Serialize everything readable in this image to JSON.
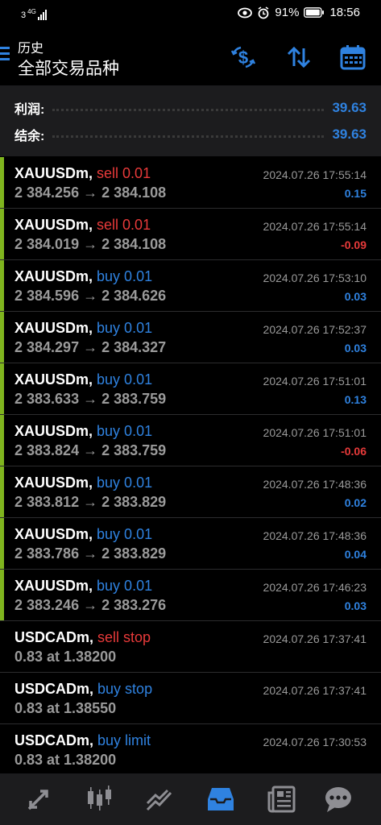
{
  "status_bar": {
    "network": "4G",
    "sim": "3",
    "battery": "91%",
    "time": "18:56"
  },
  "header": {
    "section": "历史",
    "title": "全部交易品种"
  },
  "summary": {
    "profit_label": "利润:",
    "profit_value": "39.63",
    "balance_label": "结余:",
    "balance_value": "39.63"
  },
  "rows": [
    {
      "symbol": "XAUUSDm,",
      "type": "sell 0.01",
      "side": "sell",
      "prices": "2 384.256 → 2 384.108",
      "time": "2024.07.26 17:55:14",
      "pl": "0.15",
      "pl_sign": "pos",
      "closed": true
    },
    {
      "symbol": "XAUUSDm,",
      "type": "sell 0.01",
      "side": "sell",
      "prices": "2 384.019 → 2 384.108",
      "time": "2024.07.26 17:55:14",
      "pl": "-0.09",
      "pl_sign": "neg",
      "closed": true
    },
    {
      "symbol": "XAUUSDm,",
      "type": "buy 0.01",
      "side": "buy",
      "prices": "2 384.596 → 2 384.626",
      "time": "2024.07.26 17:53:10",
      "pl": "0.03",
      "pl_sign": "pos",
      "closed": true
    },
    {
      "symbol": "XAUUSDm,",
      "type": "buy 0.01",
      "side": "buy",
      "prices": "2 384.297 → 2 384.327",
      "time": "2024.07.26 17:52:37",
      "pl": "0.03",
      "pl_sign": "pos",
      "closed": true
    },
    {
      "symbol": "XAUUSDm,",
      "type": "buy 0.01",
      "side": "buy",
      "prices": "2 383.633 → 2 383.759",
      "time": "2024.07.26 17:51:01",
      "pl": "0.13",
      "pl_sign": "pos",
      "closed": true
    },
    {
      "symbol": "XAUUSDm,",
      "type": "buy 0.01",
      "side": "buy",
      "prices": "2 383.824 → 2 383.759",
      "time": "2024.07.26 17:51:01",
      "pl": "-0.06",
      "pl_sign": "neg",
      "closed": true
    },
    {
      "symbol": "XAUUSDm,",
      "type": "buy 0.01",
      "side": "buy",
      "prices": "2 383.812 → 2 383.829",
      "time": "2024.07.26 17:48:36",
      "pl": "0.02",
      "pl_sign": "pos",
      "closed": true
    },
    {
      "symbol": "XAUUSDm,",
      "type": "buy 0.01",
      "side": "buy",
      "prices": "2 383.786 → 2 383.829",
      "time": "2024.07.26 17:48:36",
      "pl": "0.04",
      "pl_sign": "pos",
      "closed": true
    },
    {
      "symbol": "XAUUSDm,",
      "type": "buy 0.01",
      "side": "buy",
      "prices": "2 383.246 → 2 383.276",
      "time": "2024.07.26 17:46:23",
      "pl": "0.03",
      "pl_sign": "pos",
      "closed": true
    },
    {
      "symbol": "USDCADm,",
      "type": "sell stop",
      "side": "sell",
      "prices": "0.83 at 1.38200",
      "time": "2024.07.26 17:37:41",
      "pl": "",
      "pl_sign": "pos",
      "closed": false
    },
    {
      "symbol": "USDCADm,",
      "type": "buy stop",
      "side": "buy",
      "prices": "0.83 at 1.38550",
      "time": "2024.07.26 17:37:41",
      "pl": "",
      "pl_sign": "pos",
      "closed": false
    },
    {
      "symbol": "USDCADm,",
      "type": "buy limit",
      "side": "buy",
      "prices": "0.83 at 1.38200",
      "time": "2024.07.26 17:30:53",
      "pl": "",
      "pl_sign": "pos",
      "closed": false
    }
  ],
  "bottom_nav": [
    {
      "name": "quotes-icon",
      "active": false
    },
    {
      "name": "chart-candles-icon",
      "active": false
    },
    {
      "name": "trade-icon",
      "active": false
    },
    {
      "name": "history-icon",
      "active": true
    },
    {
      "name": "news-icon",
      "active": false
    },
    {
      "name": "chat-icon",
      "active": false
    }
  ],
  "colors": {
    "accent": "#2f82e0",
    "sell": "#e83a3a",
    "closed_bar": "#7fb41e",
    "inactive_icon": "#8e8e93"
  }
}
